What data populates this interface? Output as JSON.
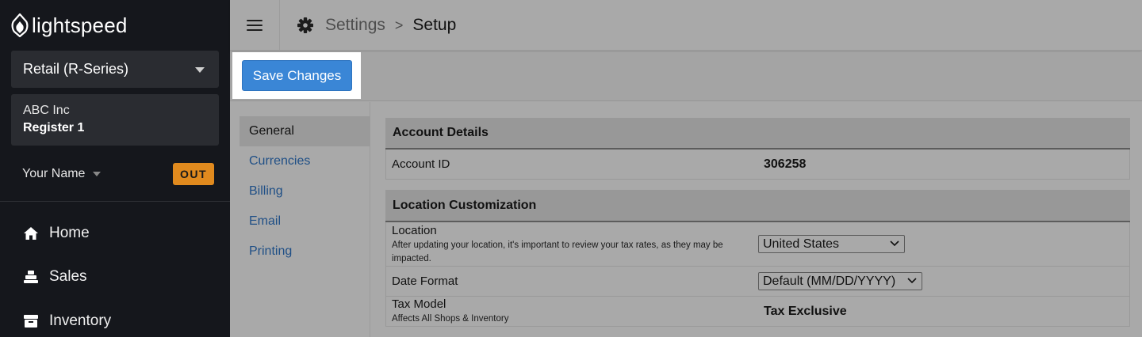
{
  "app": {
    "brand": "lightspeed"
  },
  "sidebar": {
    "product": "Retail (R-Series)",
    "company": "ABC Inc",
    "register": "Register 1",
    "user_name": "Your Name",
    "status_badge": "OUT",
    "nav": [
      {
        "label": "Home",
        "icon": "home-icon"
      },
      {
        "label": "Sales",
        "icon": "register-icon"
      },
      {
        "label": "Inventory",
        "icon": "inventory-icon"
      }
    ]
  },
  "header": {
    "breadcrumb_root": "Settings",
    "breadcrumb_separator": ">",
    "breadcrumb_current": "Setup"
  },
  "toolbar": {
    "save_label": "Save Changes"
  },
  "tabs": [
    "General",
    "Currencies",
    "Billing",
    "Email",
    "Printing"
  ],
  "account_details": {
    "title": "Account Details",
    "account_id_label": "Account ID",
    "account_id_value": "306258"
  },
  "location_customization": {
    "title": "Location Customization",
    "location_label": "Location",
    "location_note_1": "After updating your location, it's important to review your tax rates, as they may be",
    "location_note_2": "impacted.",
    "location_value": "United States",
    "date_format_label": "Date Format",
    "date_format_value": "Default (MM/DD/YYYY)",
    "tax_model_label": "Tax Model",
    "tax_model_note": "Affects All Shops & Inventory",
    "tax_model_value": "Tax Exclusive"
  },
  "colors": {
    "accent": "#3a86d6",
    "badge": "#e08a1e",
    "sidebar_bg": "#15171c",
    "link": "#1f4f86"
  }
}
